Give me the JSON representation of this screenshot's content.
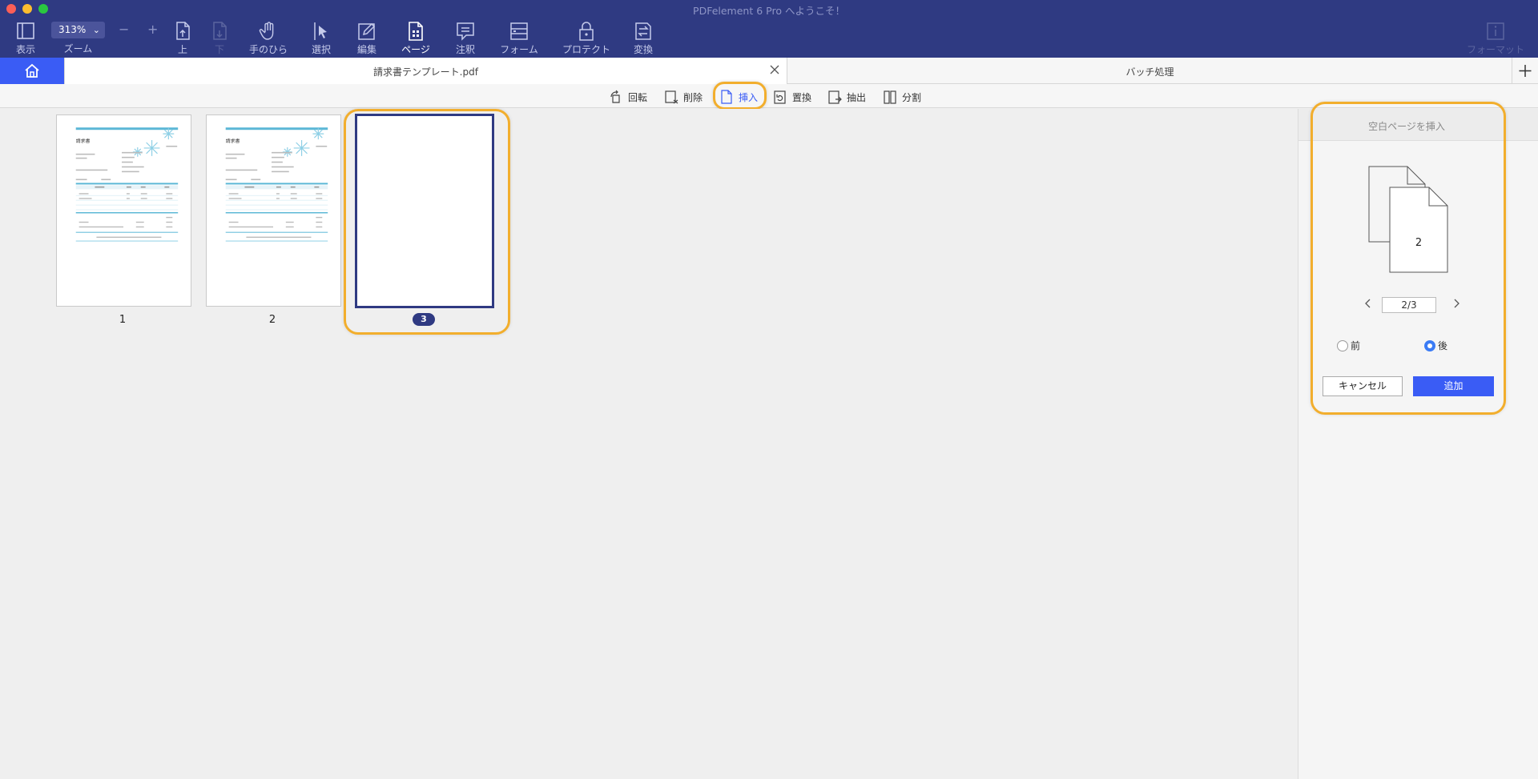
{
  "window": {
    "title": "PDFelement 6 Pro へようこそ！"
  },
  "toolbar": {
    "view": "表示",
    "zoom_value": "313%",
    "zoom_label": "ズーム",
    "zoom_minus": "−",
    "zoom_plus": "+",
    "up": "上",
    "down": "下",
    "hand": "手のひら",
    "select": "選択",
    "edit": "編集",
    "page": "ページ",
    "comment": "注釈",
    "form": "フォーム",
    "protect": "プロテクト",
    "convert": "変換",
    "format": "フォーマット"
  },
  "tabs": {
    "document": "請求書テンプレート.pdf",
    "batch": "バッチ処理"
  },
  "page_tools": {
    "rotate": "回転",
    "delete": "削除",
    "insert": "挿入",
    "replace": "置換",
    "extract": "抽出",
    "split": "分割"
  },
  "thumbnails": [
    {
      "number": "1",
      "kind": "invoice"
    },
    {
      "number": "2",
      "kind": "invoice"
    },
    {
      "number": "3",
      "kind": "blank",
      "selected": true
    }
  ],
  "invoice_thumb": {
    "heading": "請求書"
  },
  "insert_panel": {
    "title": "空白ページを挿入",
    "preview_number": "2",
    "page_value": "2/3",
    "before_label": "前",
    "after_label": "後",
    "position": "after",
    "cancel": "キャンセル",
    "add": "追加"
  },
  "colors": {
    "toolbar": "#2f3a82",
    "accent": "#3a5cf5",
    "highlight": "#f2ae2d"
  }
}
